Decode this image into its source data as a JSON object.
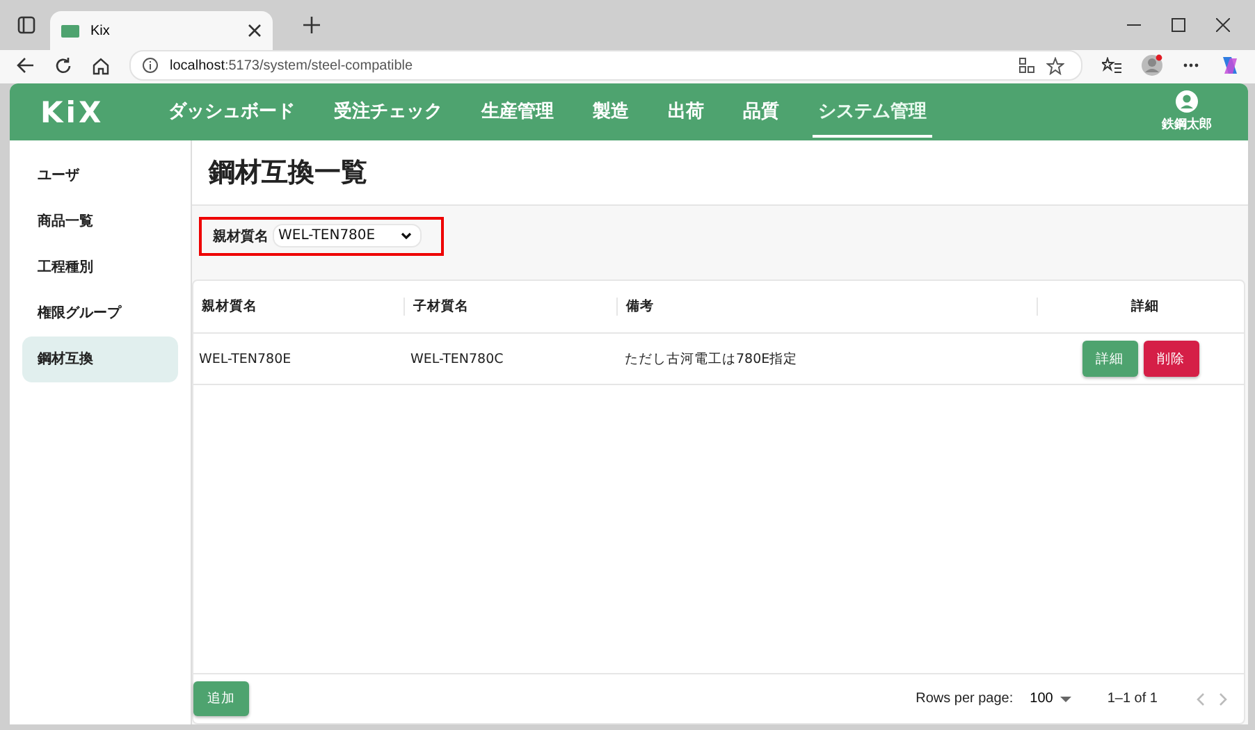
{
  "browser": {
    "tab_title": "Kix",
    "url_host": "localhost",
    "url_rest": ":5173/system/steel-compatible"
  },
  "header": {
    "logo": "KiX",
    "nav": [
      {
        "label": "ダッシュボード",
        "selected": false
      },
      {
        "label": "受注チェック",
        "selected": false
      },
      {
        "label": "生産管理",
        "selected": false
      },
      {
        "label": "製造",
        "selected": false
      },
      {
        "label": "出荷",
        "selected": false
      },
      {
        "label": "品質",
        "selected": false
      },
      {
        "label": "システム管理",
        "selected": true
      }
    ],
    "user": "鉄鋼太郎"
  },
  "sidebar": {
    "items": [
      {
        "label": "ユーザ",
        "selected": false
      },
      {
        "label": "商品一覧",
        "selected": false
      },
      {
        "label": "工程種別",
        "selected": false
      },
      {
        "label": "権限グループ",
        "selected": false
      },
      {
        "label": "鋼材互換",
        "selected": true
      }
    ]
  },
  "page_title": "鋼材互換一覧",
  "filter": {
    "label": "親材質名",
    "value": "WEL-TEN780E"
  },
  "table": {
    "columns": [
      "親材質名",
      "子材質名",
      "備考",
      "詳細"
    ],
    "rows": [
      {
        "cells": [
          "WEL-TEN780E",
          "WEL-TEN780C",
          "ただし古河電工は780E指定"
        ],
        "actions": [
          "詳細",
          "削除"
        ]
      }
    ]
  },
  "add_button": "追加",
  "pagination": {
    "rows_per_page_label": "Rows per page:",
    "rows_per_page": "100",
    "range": "1–1 of 1"
  }
}
